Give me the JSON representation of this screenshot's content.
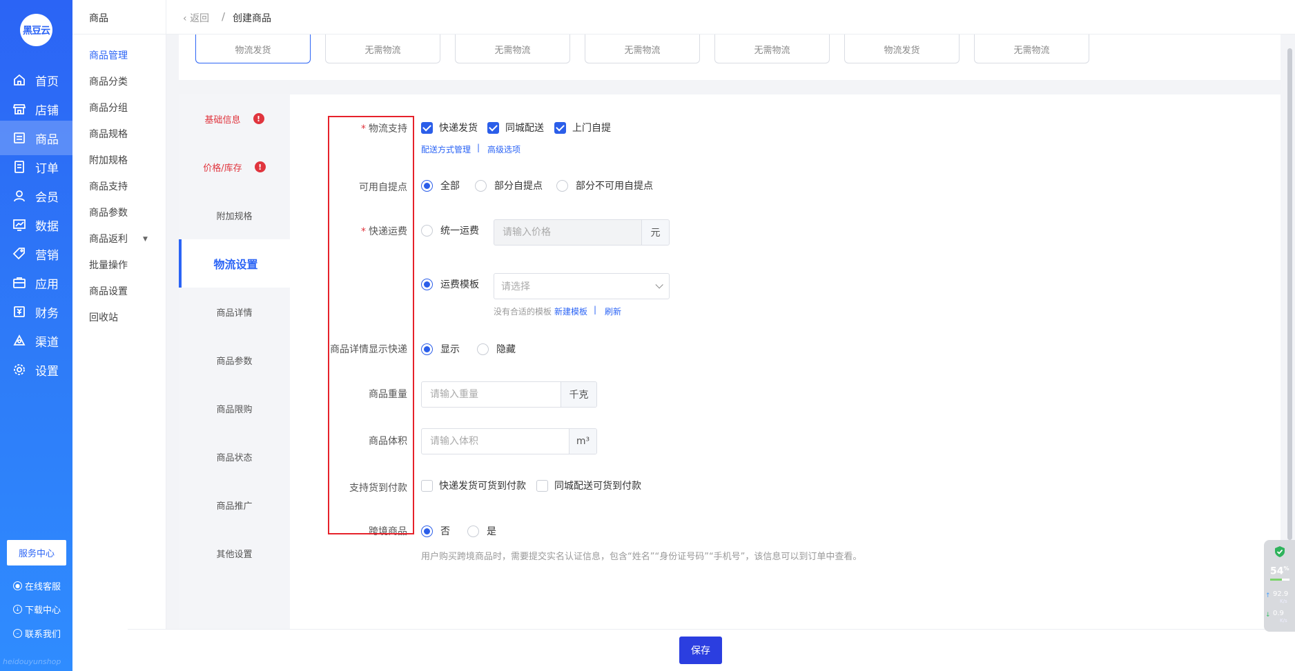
{
  "brand": {
    "logo_text": "黑豆云",
    "watermark": "heidouyunshop"
  },
  "main_nav": [
    {
      "label": "首页",
      "icon": "home-icon",
      "active": false
    },
    {
      "label": "店铺",
      "icon": "store-icon",
      "active": false
    },
    {
      "label": "商品",
      "icon": "product-icon",
      "active": true
    },
    {
      "label": "订单",
      "icon": "order-icon",
      "active": false
    },
    {
      "label": "会员",
      "icon": "member-icon",
      "active": false
    },
    {
      "label": "数据",
      "icon": "data-icon",
      "active": false
    },
    {
      "label": "营销",
      "icon": "marketing-tag-icon",
      "active": false
    },
    {
      "label": "应用",
      "icon": "app-icon",
      "active": false
    },
    {
      "label": "财务",
      "icon": "finance-icon",
      "active": false
    },
    {
      "label": "渠道",
      "icon": "channel-icon",
      "active": false
    },
    {
      "label": "设置",
      "icon": "settings-gear-icon",
      "active": false
    }
  ],
  "sidebar_footer": {
    "service_center": "服务中心",
    "online_service": "在线客服",
    "download_center": "下载中心",
    "contact_us": "联系我们"
  },
  "submenu": {
    "title": "商品",
    "items": [
      "商品管理",
      "商品分类",
      "商品分组",
      "商品规格",
      "附加规格",
      "商品支持",
      "商品参数",
      "商品返利",
      "批量操作",
      "商品设置",
      "回收站"
    ],
    "active_index": 0
  },
  "breadcrumb": {
    "back": "返回",
    "separator": "/",
    "current": "创建商品"
  },
  "top_cards": [
    "物流发货",
    "无需物流",
    "无需物流",
    "无需物流",
    "无需物流",
    "物流发货",
    "无需物流"
  ],
  "form_tabs": [
    {
      "label": "基础信息",
      "error": true,
      "active": false
    },
    {
      "label": "价格/库存",
      "error": true,
      "active": false
    },
    {
      "label": "附加规格",
      "error": false,
      "active": false
    },
    {
      "label": "物流设置",
      "error": false,
      "active": true
    },
    {
      "label": "商品详情",
      "error": false,
      "active": false
    },
    {
      "label": "商品参数",
      "error": false,
      "active": false
    },
    {
      "label": "商品限购",
      "error": false,
      "active": false
    },
    {
      "label": "商品状态",
      "error": false,
      "active": false
    },
    {
      "label": "商品推广",
      "error": false,
      "active": false
    },
    {
      "label": "其他设置",
      "error": false,
      "active": false
    }
  ],
  "form": {
    "error_mark": "!",
    "required_mark": "*",
    "logistics_support": {
      "label": "物流支持",
      "options": [
        {
          "label": "快递发货",
          "checked": true
        },
        {
          "label": "同城配送",
          "checked": true
        },
        {
          "label": "上门自提",
          "checked": true
        }
      ],
      "links": [
        "配送方式管理",
        "高级选项"
      ],
      "link_sep": "|"
    },
    "pickup_points": {
      "label": "可用自提点",
      "options": [
        {
          "label": "全部",
          "selected": true
        },
        {
          "label": "部分自提点",
          "selected": false
        },
        {
          "label": "部分不可用自提点",
          "selected": false
        }
      ]
    },
    "shipping_fee": {
      "label": "快递运费",
      "unified": {
        "label": "统一运费",
        "selected": false,
        "placeholder": "请输入价格",
        "unit": "元"
      },
      "template": {
        "label": "运费模板",
        "selected": true,
        "placeholder": "请选择"
      },
      "hint": "没有合适的模板",
      "new_template": "新建模板",
      "refresh": "刷新",
      "sep": "|"
    },
    "detail_show_express": {
      "label": "商品详情显示快递",
      "options": [
        {
          "label": "显示",
          "selected": true
        },
        {
          "label": "隐藏",
          "selected": false
        }
      ]
    },
    "weight": {
      "label": "商品重量",
      "placeholder": "请输入重量",
      "unit": "千克"
    },
    "volume": {
      "label": "商品体积",
      "placeholder": "请输入体积",
      "unit": "m³"
    },
    "cod": {
      "label": "支持货到付款",
      "options": [
        {
          "label": "快递发货可货到付款",
          "checked": false
        },
        {
          "label": "同城配送可货到付款",
          "checked": false
        }
      ]
    },
    "cross_border": {
      "label": "跨境商品",
      "options": [
        {
          "label": "否",
          "selected": true
        },
        {
          "label": "是",
          "selected": false
        }
      ],
      "hint": "用户购买跨境商品时，需要提交实名认证信息，包含“姓名”“身份证号码”“手机号”，该信息可以到订单中查看。"
    }
  },
  "save_label": "保存",
  "net_widget": {
    "percent": "54",
    "percent_unit": "%",
    "up": "92.9",
    "down": "0.9",
    "unit": "K/s",
    "up_arrow": "↑",
    "down_arrow": "↓",
    "usage_fraction": 0.6
  },
  "colors": {
    "primary": "#2b64f5",
    "error": "#e0353e",
    "save": "#2b3ee0"
  }
}
